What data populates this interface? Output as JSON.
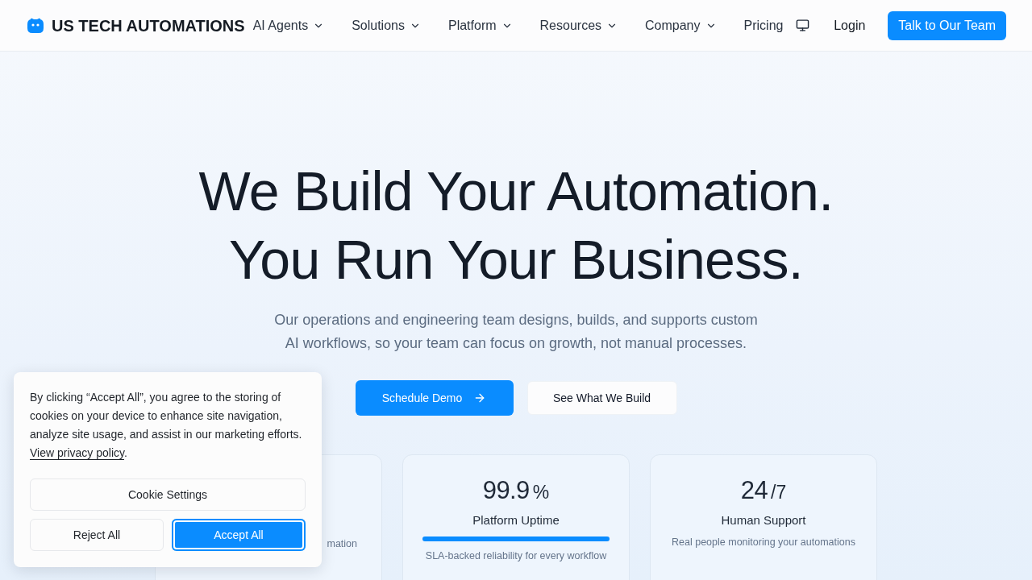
{
  "header": {
    "brand": "US TECH AUTOMATIONS",
    "nav": [
      {
        "label": "AI Agents",
        "has_menu": true
      },
      {
        "label": "Solutions",
        "has_menu": true
      },
      {
        "label": "Platform",
        "has_menu": true
      },
      {
        "label": "Resources",
        "has_menu": true
      },
      {
        "label": "Company",
        "has_menu": true
      },
      {
        "label": "Pricing",
        "has_menu": false
      }
    ],
    "login": "Login",
    "cta": "Talk to Our Team"
  },
  "hero": {
    "title_lines": [
      "We Build Your Automation.",
      "You Run Your Business."
    ],
    "subtitle": "Our operations and engineering team designs, builds, and supports custom AI workflows, so your team can focus on growth, not manual processes.",
    "buttons": [
      {
        "label": "Schedule Demo",
        "kind": "primary"
      },
      {
        "label": "See What We Build",
        "kind": "secondary"
      }
    ]
  },
  "stats": [
    {
      "kind": "covered",
      "description": "mation"
    },
    {
      "kind": "meter",
      "value": "99.9",
      "unit": "%",
      "title": "Platform Uptime",
      "level": 1,
      "description": "SLA-backed reliability for every workflow"
    },
    {
      "kind": "stat",
      "value": "24",
      "unit": "/7",
      "title": "Human Support",
      "description": "Real people monitoring your automations"
    }
  ],
  "cookie_banner": {
    "text": "By clicking “Accept All”, you agree to the storing of cookies on your device to enhance site navigation, analyze site usage, and assist in our marketing efforts.",
    "link": "View privacy policy",
    "text_after": ".",
    "buttons": [
      {
        "label": "Cookie Settings",
        "kind": "outline",
        "focused": false
      },
      {
        "label": "Reject All",
        "kind": "outline",
        "focused": false
      },
      {
        "label": "Accept All",
        "kind": "primary",
        "focused": true
      }
    ]
  }
}
